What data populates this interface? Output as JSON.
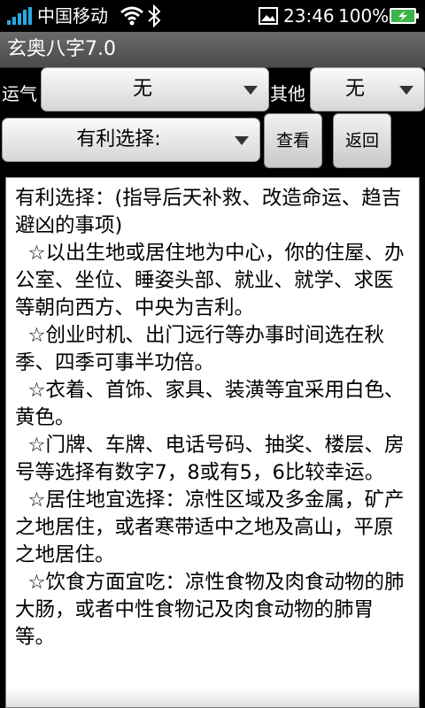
{
  "status_bar": {
    "carrier": "中国移动",
    "time": "23:46",
    "battery_percent": "100%"
  },
  "app": {
    "title": "玄奥八字7.0"
  },
  "controls": {
    "yunqi_label": "运气",
    "yunqi_value": "无",
    "qita_label": "其他",
    "qita_value": "无",
    "youli_value": "有利选择:",
    "view_button": "查看",
    "back_button": "返回"
  },
  "content": {
    "paragraphs": [
      "有利选择：(指导后天补救、改造命运、趋吉避凶的事项)",
      "  ☆以出生地或居住地为中心，你的住屋、办公室、坐位、睡姿头部、就业、就学、求医等朝向西方、中央为吉利。",
      "  ☆创业时机、出门远行等办事时间选在秋季、四季可事半功倍。",
      "  ☆衣着、首饰、家具、装潢等宜采用白色、黄色。",
      "  ☆门牌、车牌、电话号码、抽奖、楼层、房号等选择有数字7，8或有5，6比较幸运。",
      "  ☆居住地宜选择：凉性区域及多金属，矿产之地居住，或者寒带适中之地及高山，平原之地居住。",
      "  ☆饮食方面宜吃：凉性食物及肉食动物的肺大肠，或者中性食物记及肉食动物的肺胃等。"
    ]
  }
}
